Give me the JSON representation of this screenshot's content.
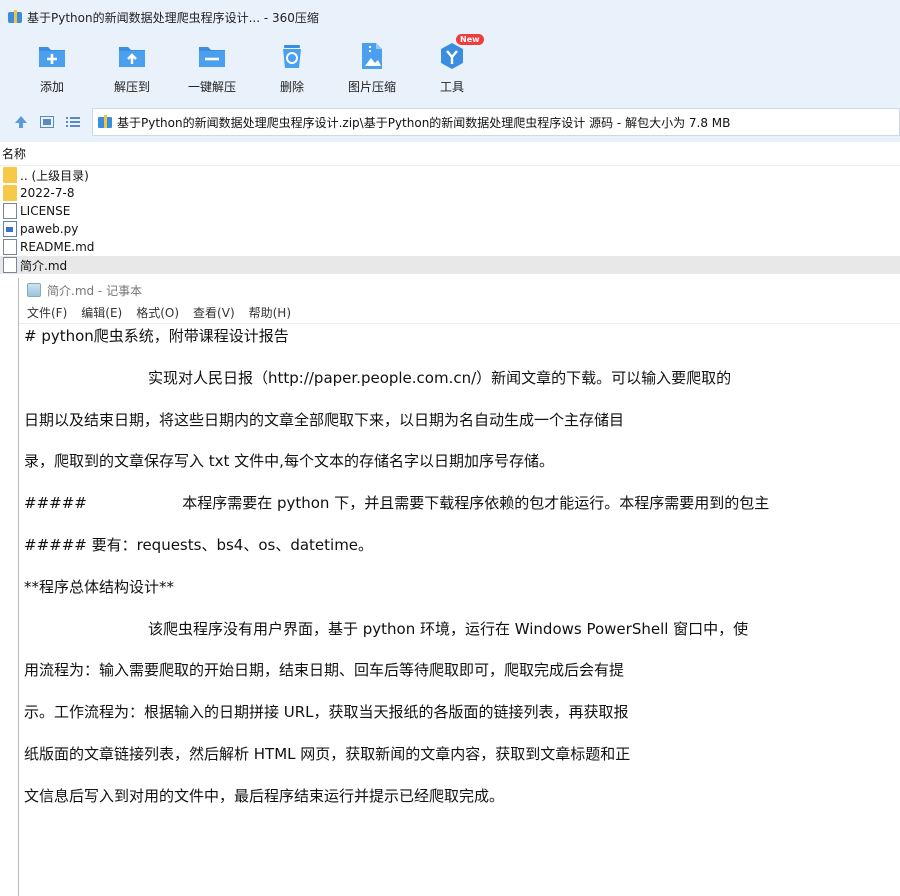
{
  "window": {
    "title": "基于Python的新闻数据处理爬虫程序设计... - 360压缩"
  },
  "toolbar": {
    "items": [
      {
        "label": "添加",
        "icon": "add-icon"
      },
      {
        "label": "解压到",
        "icon": "extract-to-icon"
      },
      {
        "label": "一键解压",
        "icon": "one-click-extract-icon"
      },
      {
        "label": "删除",
        "icon": "delete-icon"
      },
      {
        "label": "图片压缩",
        "icon": "image-compress-icon"
      },
      {
        "label": "工具",
        "icon": "tools-icon",
        "badge": "New"
      }
    ]
  },
  "address": {
    "path": "基于Python的新闻数据处理爬虫程序设计.zip\\基于Python的新闻数据处理爬虫程序设计 源码 - 解包大小为 7.8 MB"
  },
  "filelist": {
    "column_name": "名称",
    "files": [
      {
        "name": ".. (上级目录)",
        "type": "folder"
      },
      {
        "name": "2022-7-8",
        "type": "folder"
      },
      {
        "name": "LICENSE",
        "type": "doc"
      },
      {
        "name": "paweb.py",
        "type": "py"
      },
      {
        "name": "README.md",
        "type": "doc"
      },
      {
        "name": "简介.md",
        "type": "doc",
        "selected": true
      }
    ]
  },
  "notepad": {
    "title": "简介.md - 记事本",
    "menu": [
      "文件(F)",
      "编辑(E)",
      "格式(O)",
      "查看(V)",
      "帮助(H)"
    ],
    "lines": [
      "# python爬虫系统，附带课程设计报告",
      "                          实现对人民日报（http://paper.people.com.cn/）新闻文章的下载。可以输入要爬取的",
      "日期以及结束日期，将这些日期内的文章全部爬取下来，以日期为名自动生成一个主存储目",
      "录，爬取到的文章保存写入 txt 文件中,每个文本的存储名字以日期加序号存储。",
      "#####                    本程序需要在 python 下，并且需要下载程序依赖的包才能运行。本程序需要用到的包主",
      "##### 要有：requests、bs4、os、datetime。",
      "**程序总体结构设计**",
      "                          该爬虫程序没有用户界面，基于 python 环境，运行在 Windows PowerShell 窗口中，使",
      "用流程为：输入需要爬取的开始日期，结束日期、回车后等待爬取即可，爬取完成后会有提",
      "示。工作流程为：根据输入的日期拼接 URL，获取当天报纸的各版面的链接列表，再获取报",
      "纸版面的文章链接列表，然后解析 HTML 网页，获取新闻的文章内容，获取到文章标题和正",
      "文信息后写入到对用的文件中，最后程序结束运行并提示已经爬取完成。"
    ]
  },
  "colors": {
    "chrome_bg": "#e9f1fb",
    "icon_blue": "#3b8de0",
    "badge_red": "#f03c3c",
    "folder_yellow": "#f7c948"
  }
}
